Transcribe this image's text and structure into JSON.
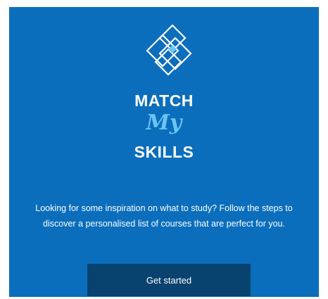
{
  "brand": {
    "line1": "MATCH",
    "line2": "My",
    "line3": "SKILLS",
    "icon": "overlapping-diamonds-logo-icon"
  },
  "intro": {
    "text": "Looking for some inspiration on what to study? Follow the steps to discover a personalised list of courses that are perfect for you."
  },
  "cta": {
    "label": "Get started"
  },
  "colors": {
    "panel_background": "#0a6ebd",
    "accent_light_blue": "#6cc4f3",
    "button_background": "#08426f",
    "text": "#ffffff"
  }
}
